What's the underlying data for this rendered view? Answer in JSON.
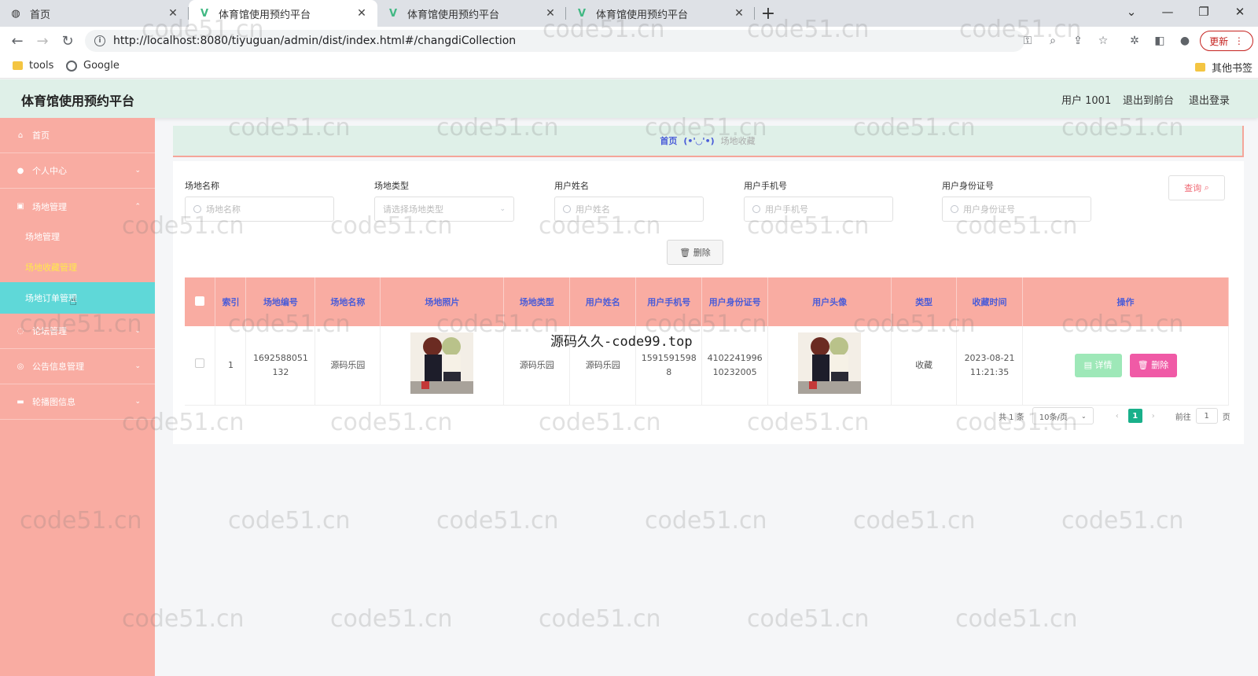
{
  "browser": {
    "tabs": [
      {
        "title": "首页",
        "active": false
      },
      {
        "title": "体育馆使用预约平台",
        "active": true
      },
      {
        "title": "体育馆使用预约平台",
        "active": false
      },
      {
        "title": "体育馆使用预约平台",
        "active": false
      }
    ],
    "url": "http://localhost:8080/tiyuguan/admin/dist/index.html#/changdiCollection",
    "update_label": "更新",
    "bookmarks": [
      "tools",
      "Google"
    ],
    "other_bookmarks": "其他书签"
  },
  "header": {
    "title": "体育馆使用预约平台",
    "user": "用户 1001",
    "back_to_front": "退出到前台",
    "logout": "退出登录"
  },
  "sidebar": {
    "items": [
      {
        "label": "首页",
        "icon": "home-icon"
      },
      {
        "label": "个人中心",
        "icon": "user-icon"
      },
      {
        "label": "场地管理",
        "icon": "building-icon"
      },
      {
        "label": "论坛管理",
        "icon": "forum-icon"
      },
      {
        "label": "公告信息管理",
        "icon": "notice-icon"
      },
      {
        "label": "轮播图信息",
        "icon": "monitor-icon"
      }
    ],
    "sub_items": [
      {
        "label": "场地管理"
      },
      {
        "label": "场地收藏管理"
      },
      {
        "label": "场地订单管理"
      }
    ]
  },
  "breadcrumb": {
    "home": "首页",
    "sep": "(•'◡'•)",
    "current": "场地收藏"
  },
  "search": {
    "fields": [
      {
        "label": "场地名称",
        "placeholder": "场地名称"
      },
      {
        "label": "场地类型",
        "placeholder": "请选择场地类型"
      },
      {
        "label": "用户姓名",
        "placeholder": "用户姓名"
      },
      {
        "label": "用户手机号",
        "placeholder": "用户手机号"
      },
      {
        "label": "用户身份证号",
        "placeholder": "用户身份证号"
      }
    ],
    "query_label": "查询",
    "bulk_delete_label": "删除"
  },
  "table": {
    "columns": [
      "索引",
      "场地编号",
      "场地名称",
      "场地照片",
      "场地类型",
      "用户姓名",
      "用户手机号",
      "用户身份证号",
      "用户头像",
      "类型",
      "收藏时间",
      "操作"
    ],
    "rows": [
      {
        "index": "1",
        "code": "1692588051132",
        "name": "源码乐园",
        "type": "源码乐园",
        "user_name": "源码乐园",
        "phone": "15915915988",
        "id_card": "410224199610232005",
        "kind": "收藏",
        "time": "2023-08-21 11:21:35",
        "detail_label": "详情",
        "delete_label": "删除"
      }
    ]
  },
  "pager": {
    "total": "共 1 条",
    "page_size": "10条/页",
    "current_page": "1",
    "goto_label": "前往",
    "goto_value": "1",
    "page_suffix": "页"
  },
  "overlay_text": "源码久久-code99.top",
  "watermark": "code51.cn"
}
